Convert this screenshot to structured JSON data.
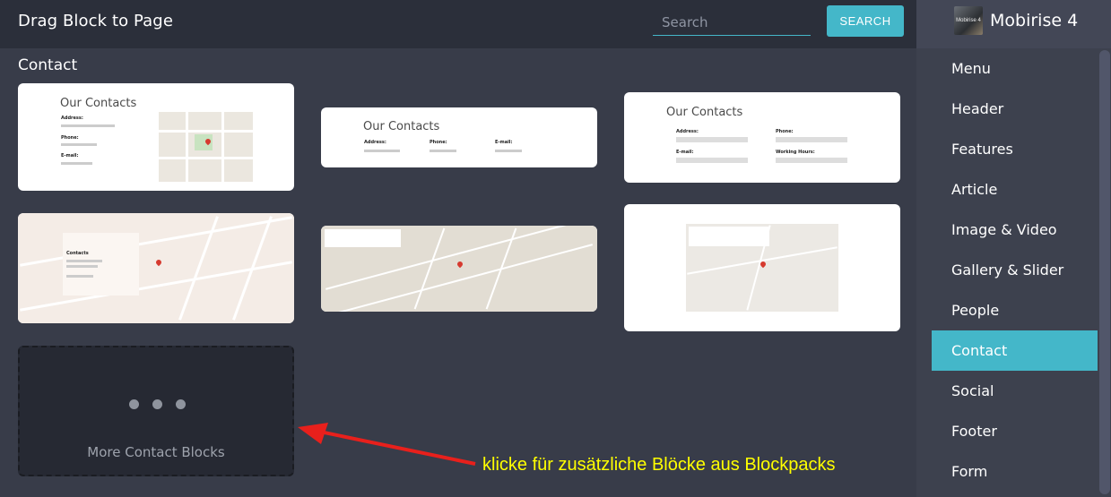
{
  "header": {
    "title": "Drag Block to Page",
    "search_placeholder": "Search",
    "search_button": "SEARCH"
  },
  "brand": {
    "name": "Mobirise 4",
    "logo_text": "Mobirise 4"
  },
  "sidebar": {
    "items": [
      {
        "label": "Menu",
        "active": false
      },
      {
        "label": "Header",
        "active": false
      },
      {
        "label": "Features",
        "active": false
      },
      {
        "label": "Article",
        "active": false
      },
      {
        "label": "Image & Video",
        "active": false
      },
      {
        "label": "Gallery & Slider",
        "active": false
      },
      {
        "label": "People",
        "active": false
      },
      {
        "label": "Contact",
        "active": true
      },
      {
        "label": "Social",
        "active": false
      },
      {
        "label": "Footer",
        "active": false
      },
      {
        "label": "Form",
        "active": false
      }
    ]
  },
  "section": {
    "title": "Contact"
  },
  "cards": {
    "c1": {
      "title": "Our Contacts",
      "address": "Address:",
      "phone": "Phone:",
      "email": "E-mail:"
    },
    "c2": {
      "title": "Our Contacts",
      "address": "Address:",
      "phone": "Phone:",
      "email": "E-mail:"
    },
    "c3": {
      "title": "Our Contacts",
      "address": "Address:",
      "phone": "Phone:",
      "email": "E-mail:",
      "hours": "Working Hours:"
    },
    "c4": {
      "contacts": "Contacts"
    }
  },
  "more": {
    "label": "More Contact Blocks"
  },
  "annotation": "klicke für zusätzliche Blöcke aus Blockpacks",
  "colors": {
    "accent": "#44b7c9",
    "annotation": "#ffff00",
    "arrow": "#e8201c"
  }
}
